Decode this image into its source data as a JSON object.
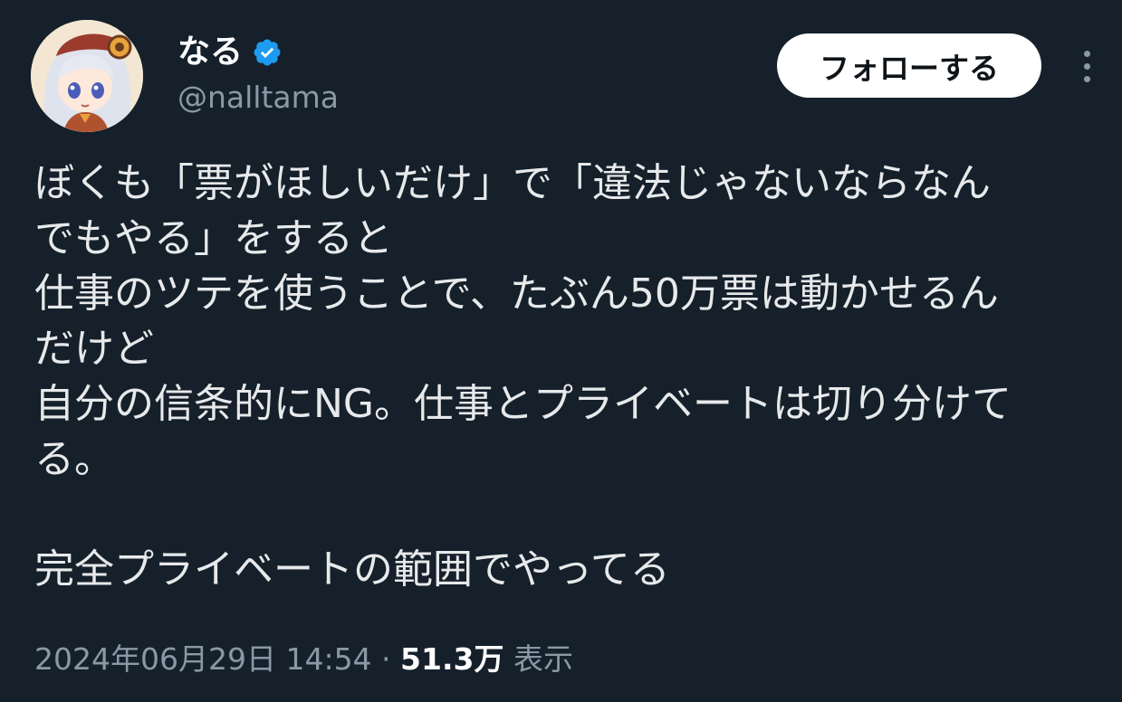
{
  "author": {
    "display_name": "なる",
    "handle": "@nalltama",
    "verified": true
  },
  "actions": {
    "follow_label": "フォローする"
  },
  "tweet": {
    "lines": [
      "ぼくも「票がほしいだけ」で「違法じゃないならなん",
      "でもやる」をすると",
      "仕事のツテを使うことで、たぶん50万票は動かせるん",
      "だけど",
      "自分の信条的にNG。仕事とプライベートは切り分けて",
      "る。",
      "",
      "完全プライベートの範囲でやってる"
    ]
  },
  "meta": {
    "timestamp": "2024年06月29日 14:54",
    "separator": " · ",
    "views_count": "51.3万",
    "views_label": " 表示"
  },
  "colors": {
    "background": "#15202b",
    "text_primary": "#e7e9ea",
    "text_secondary": "#8b98a5",
    "verified_blue": "#1d9bf0"
  }
}
